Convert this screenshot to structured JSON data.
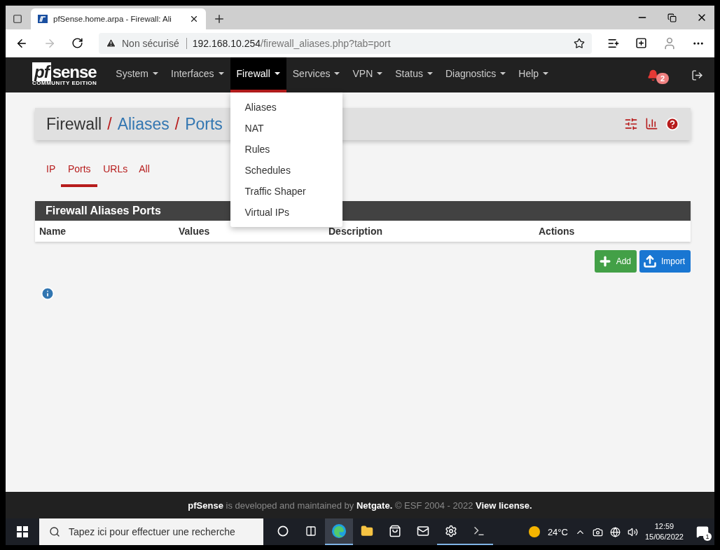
{
  "browser": {
    "tab_title": "pfSense.home.arpa - Firewall: Ali",
    "security": "Non sécurisé",
    "host": "192.168.10.254",
    "path": "/firewall_aliases.php?tab=port"
  },
  "navbar": {
    "logo_prefix": "pf",
    "logo_main": "sense",
    "logo_sub": "COMMUNITY EDITION",
    "notification_count": "2",
    "menus": [
      {
        "label": "System",
        "selected": false
      },
      {
        "label": "Interfaces",
        "selected": false
      },
      {
        "label": "Firewall",
        "selected": true
      },
      {
        "label": "Services",
        "selected": false
      },
      {
        "label": "VPN",
        "selected": false
      },
      {
        "label": "Status",
        "selected": false
      },
      {
        "label": "Diagnostics",
        "selected": false
      },
      {
        "label": "Help",
        "selected": false
      }
    ]
  },
  "dropdown": {
    "items": [
      "Aliases",
      "NAT",
      "Rules",
      "Schedules",
      "Traffic Shaper",
      "Virtual IPs"
    ]
  },
  "breadcrumb": {
    "separator": "/",
    "items": [
      "Firewall",
      "Aliases",
      "Ports"
    ]
  },
  "subtabs": [
    {
      "label": "IP",
      "selected": false
    },
    {
      "label": "Ports",
      "selected": true
    },
    {
      "label": "URLs",
      "selected": false
    },
    {
      "label": "All",
      "selected": false
    }
  ],
  "panel": {
    "title": "Firewall Aliases Ports",
    "columns": [
      "Name",
      "Values",
      "Description",
      "Actions"
    ]
  },
  "buttons": [
    {
      "kind": "add",
      "label": "Add"
    },
    {
      "kind": "import",
      "label": "Import"
    }
  ],
  "footer": "**pfSense** is developed and maintained by **Netgate.** © ESF 2004 - 2022 **View license.**",
  "taskbar": {
    "search_placeholder": "Tapez ici pour effectuer une recherche",
    "weather": "24°C",
    "time": "12:59",
    "date": "15/06/2022",
    "notification_count": "1",
    "apps": [
      {
        "kind": "cortana",
        "selected": false,
        "running": false
      },
      {
        "kind": "taskview",
        "selected": false,
        "running": false
      },
      {
        "kind": "edge",
        "selected": true,
        "running": true
      },
      {
        "kind": "explorer",
        "selected": false,
        "running": false
      },
      {
        "kind": "store",
        "selected": false,
        "running": false
      },
      {
        "kind": "mail",
        "selected": false,
        "running": false
      },
      {
        "kind": "settings",
        "selected": false,
        "running": true
      },
      {
        "kind": "terminal",
        "selected": false,
        "running": true
      }
    ]
  }
}
